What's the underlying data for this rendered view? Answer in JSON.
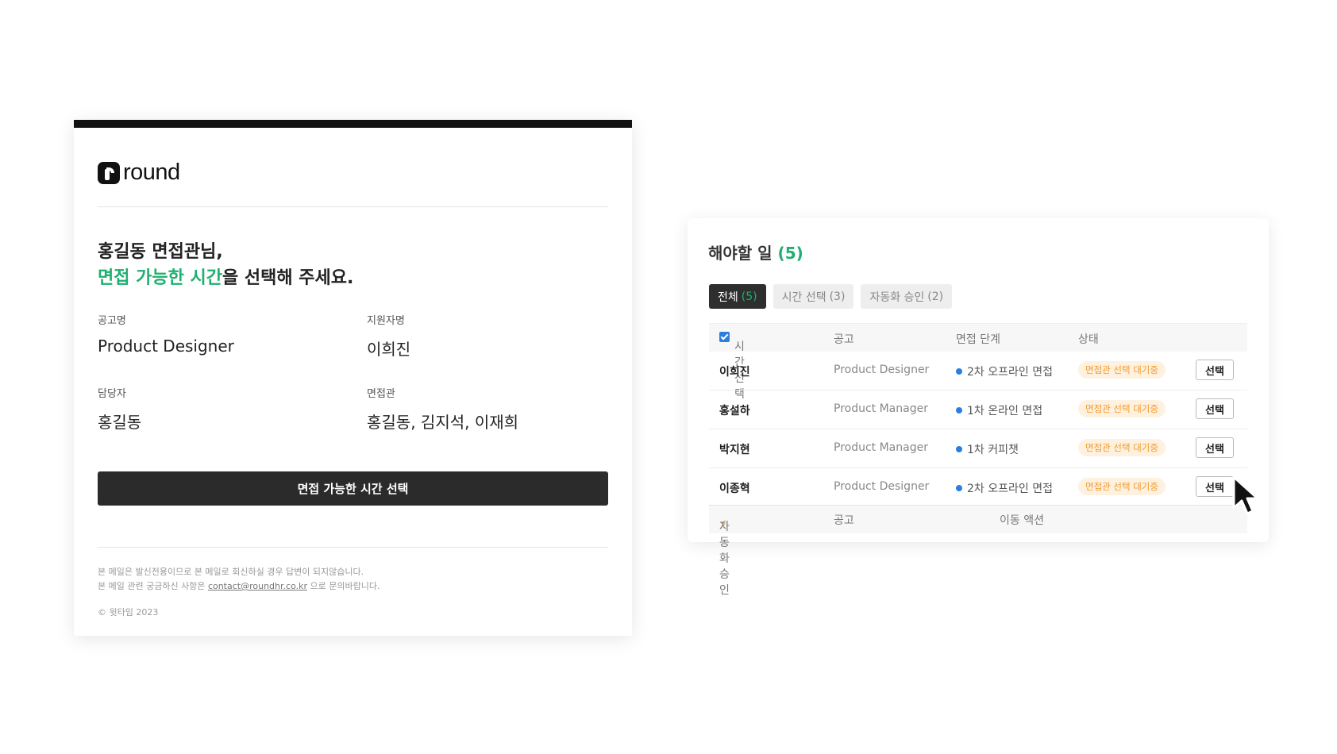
{
  "email": {
    "logo_text": "round",
    "greeting_line1": "홍길동 면접관님,",
    "greeting_highlight": "면접 가능한 시간",
    "greeting_rest": "을 선택해 주세요.",
    "fields": [
      {
        "label": "공고명",
        "value": "Product Designer"
      },
      {
        "label": "지원자명",
        "value": "이희진"
      },
      {
        "label": "담당자",
        "value": "홍길동"
      },
      {
        "label": "면접관",
        "value": "홍길동, 김지석, 이재희"
      }
    ],
    "cta_label": "면접 가능한 시간 선택",
    "footer_line1": "본 메일은 발신전용이므로 본 메일로 회신하실 경우 답변이 되지않습니다.",
    "footer_line2_pre": "본 메일 관련 궁금하신 사항은",
    "footer_email": "contact@roundhr.co.kr",
    "footer_line2_post": "으로 문의바랍니다.",
    "copyright": "© 윗타임 2023"
  },
  "todo": {
    "title": "해야할 일",
    "title_count": "(5)",
    "tabs": [
      {
        "label": "전체",
        "count": "(5)"
      },
      {
        "label": "시간 선택",
        "count": "(3)"
      },
      {
        "label": "자동화 승인",
        "count": "(2)"
      }
    ],
    "header": {
      "col1": "시간 선택",
      "col2": "공고",
      "col3": "면접 단계",
      "col4": "상태"
    },
    "rows": [
      {
        "name": "이희진",
        "job": "Product Designer",
        "stage": "2차 오프라인 면접",
        "status": "면접관 선택 대기중",
        "action": "선택"
      },
      {
        "name": "홍설하",
        "job": "Product Manager",
        "stage": "1차 온라인 면접",
        "status": "면접관 선택 대기중",
        "action": "선택"
      },
      {
        "name": "박지현",
        "job": "Product Manager",
        "stage": "1차 커피챗",
        "status": "면접관 선택 대기중",
        "action": "선택"
      },
      {
        "name": "이종혁",
        "job": "Product Designer",
        "stage": "2차 오프라인 면접",
        "status": "면접관 선택 대기중",
        "action": "선택"
      }
    ],
    "footer": {
      "col1": "자동화 승인",
      "col2": "공고",
      "col3": "이동 액션"
    }
  },
  "icons": {
    "check": "checkbox-checked-icon",
    "bolt": "lightning-icon",
    "cursor": "mouse-pointer-icon",
    "dot": "status-dot-icon"
  },
  "colors": {
    "accent": "#1faf70",
    "badge_text": "#f09a2c",
    "badge_bg": "#fff1df",
    "dot": "#2a7ee0",
    "dark": "#2b2b2b"
  }
}
